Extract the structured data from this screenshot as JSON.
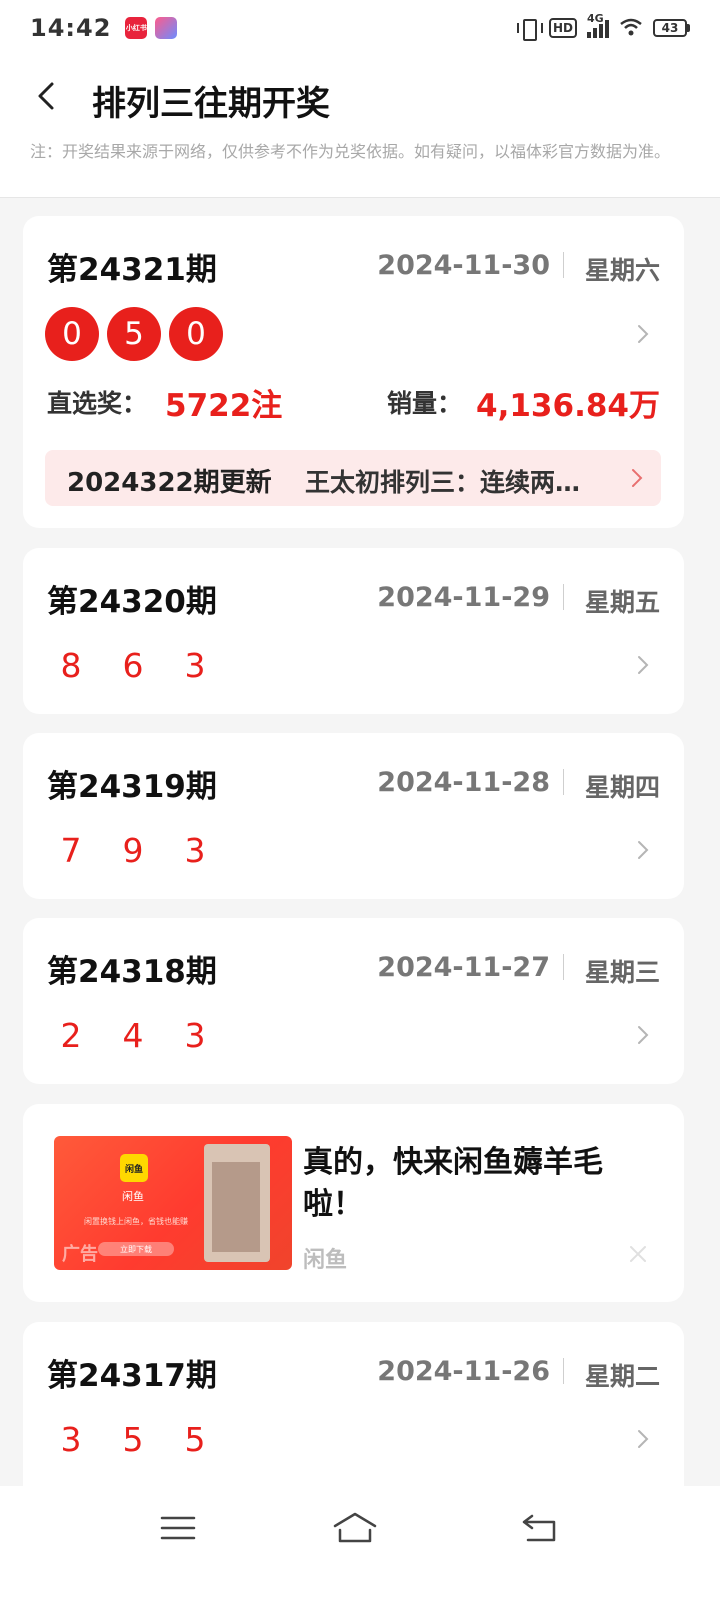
{
  "status_bar": {
    "time": "14:42",
    "app_icon_label": "小红书",
    "hd": "HD",
    "network": "4G",
    "battery": "43"
  },
  "header": {
    "title": "排列三往期开奖",
    "notice": "注：开奖结果来源于网络，仅供参考不作为兑奖依据。如有疑问，以福体彩官方数据为准。"
  },
  "latest": {
    "issue": "第24321期",
    "date": "2024-11-30",
    "weekday": "星期六",
    "numbers": [
      "0",
      "5",
      "0"
    ],
    "prize_label": "直选奖：",
    "prize_value": "5722注",
    "sales_label": "销量：",
    "sales_value": "4,136.84万",
    "news_tag": "2024322期更新",
    "news_text": "王太初排列三：连续两期直选推荐"
  },
  "draws": [
    {
      "issue": "第24320期",
      "date": "2024-11-29",
      "weekday": "星期五",
      "numbers": [
        "8",
        "6",
        "3"
      ]
    },
    {
      "issue": "第24319期",
      "date": "2024-11-28",
      "weekday": "星期四",
      "numbers": [
        "7",
        "9",
        "3"
      ]
    },
    {
      "issue": "第24318期",
      "date": "2024-11-27",
      "weekday": "星期三",
      "numbers": [
        "2",
        "4",
        "3"
      ]
    },
    {
      "issue": "第24317期",
      "date": "2024-11-26",
      "weekday": "星期二",
      "numbers": [
        "3",
        "5",
        "5"
      ]
    }
  ],
  "ad": {
    "title": "真的，快来闲鱼薅羊毛啦！",
    "source": "闲鱼",
    "badge": "广告",
    "logo_text": "闲鱼",
    "app_name": "闲鱼",
    "tagline": "闲置换钱上闲鱼，省钱也能赚",
    "download": "立即下载"
  },
  "colors": {
    "accent_red": "#e8201c",
    "news_bg": "#fdeaea",
    "page_bg": "#f5f5f5"
  },
  "icons": [
    "back-arrow-icon",
    "chevron-right-icon",
    "close-icon",
    "menu-icon",
    "home-icon",
    "return-icon"
  ]
}
